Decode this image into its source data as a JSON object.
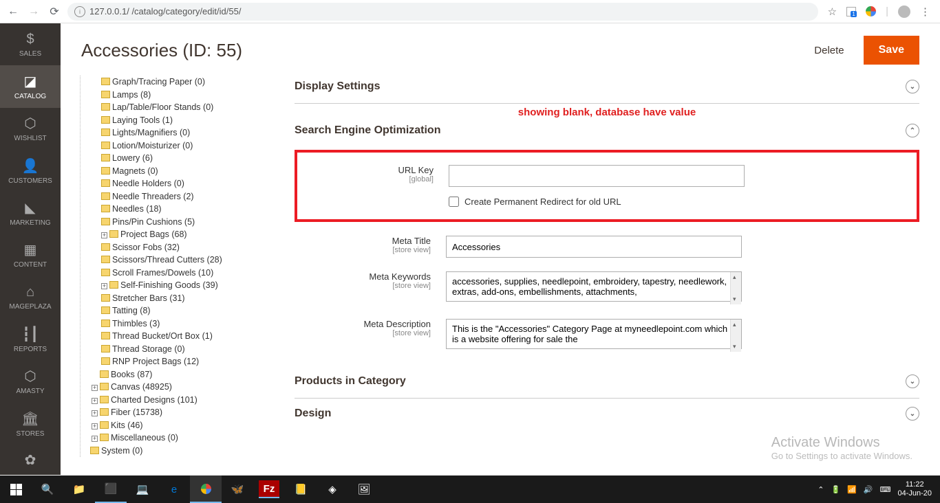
{
  "browser": {
    "url": "127.0.0.1/                                  /catalog/category/edit/id/55/"
  },
  "sidebar": {
    "items": [
      {
        "icon": "$",
        "label": "SALES"
      },
      {
        "icon": "📦",
        "label": "CATALOG"
      },
      {
        "icon": "⬡",
        "label": "WISHLIST"
      },
      {
        "icon": "👤",
        "label": "CUSTOMERS"
      },
      {
        "icon": "📣",
        "label": "MARKETING"
      },
      {
        "icon": "▦",
        "label": "CONTENT"
      },
      {
        "icon": "⌂",
        "label": "MAGEPLAZA"
      },
      {
        "icon": "📊",
        "label": "REPORTS"
      },
      {
        "icon": "⬡",
        "label": "AMASTY"
      },
      {
        "icon": "🏪",
        "label": "STORES"
      },
      {
        "icon": "⚙",
        "label": ""
      }
    ]
  },
  "page": {
    "title": "Accessories (ID: 55)",
    "delete_label": "Delete",
    "save_label": "Save"
  },
  "tree": [
    {
      "d": 1,
      "t": "Graph/Tracing Paper (0)"
    },
    {
      "d": 1,
      "t": "Lamps (8)"
    },
    {
      "d": 1,
      "t": "Lap/Table/Floor Stands (0)"
    },
    {
      "d": 1,
      "t": "Laying Tools (1)"
    },
    {
      "d": 1,
      "t": "Lights/Magnifiers (0)"
    },
    {
      "d": 1,
      "t": "Lotion/Moisturizer (0)"
    },
    {
      "d": 1,
      "t": "Lowery (6)"
    },
    {
      "d": 1,
      "t": "Magnets (0)"
    },
    {
      "d": 1,
      "t": "Needle Holders (0)"
    },
    {
      "d": 1,
      "t": "Needle Threaders (2)"
    },
    {
      "d": 1,
      "t": "Needles (18)"
    },
    {
      "d": 1,
      "t": "Pins/Pin Cushions (5)"
    },
    {
      "d": 1,
      "t": "Project Bags (68)",
      "e": true
    },
    {
      "d": 1,
      "t": "Scissor Fobs (32)"
    },
    {
      "d": 1,
      "t": "Scissors/Thread Cutters (28)"
    },
    {
      "d": 1,
      "t": "Scroll Frames/Dowels (10)"
    },
    {
      "d": 1,
      "t": "Self-Finishing Goods (39)",
      "e": true
    },
    {
      "d": 1,
      "t": "Stretcher Bars (31)"
    },
    {
      "d": 1,
      "t": "Tatting (8)"
    },
    {
      "d": 1,
      "t": "Thimbles (3)"
    },
    {
      "d": 1,
      "t": "Thread Bucket/Ort Box (1)"
    },
    {
      "d": 1,
      "t": "Thread Storage (0)"
    },
    {
      "d": 1,
      "t": "RNP Project Bags (12)"
    },
    {
      "d": 0,
      "t": "Books (87)"
    },
    {
      "d": 0,
      "t": "Canvas (48925)",
      "e": true
    },
    {
      "d": 0,
      "t": "Charted Designs (101)",
      "e": true
    },
    {
      "d": 0,
      "t": "Fiber (15738)",
      "e": true
    },
    {
      "d": 0,
      "t": "Kits (46)",
      "e": true
    },
    {
      "d": 0,
      "t": "Miscellaneous (0)",
      "e": true
    },
    {
      "d": 2,
      "t": "System (0)"
    }
  ],
  "sections": {
    "display": "Display Settings",
    "seo": "Search Engine Optimization",
    "products": "Products in Category",
    "design": "Design"
  },
  "annotation": "showing blank, database have value",
  "seo": {
    "url_key": {
      "label": "URL Key",
      "scope": "[global]",
      "value": ""
    },
    "redirect_label": "Create Permanent Redirect for old URL",
    "meta_title": {
      "label": "Meta Title",
      "scope": "[store view]",
      "value": "Accessories"
    },
    "meta_keywords": {
      "label": "Meta Keywords",
      "scope": "[store view]",
      "value": "accessories, supplies, needlepoint, embroidery, tapestry, needlework, extras, add-ons, embellishments, attachments,"
    },
    "meta_description": {
      "label": "Meta Description",
      "scope": "[store view]",
      "value": "This is the \"Accessories\" Category Page at myneedlepoint.com which is a website offering for sale the"
    }
  },
  "watermark": {
    "t1": "Activate Windows",
    "t2": "Go to Settings to activate Windows."
  },
  "taskbar": {
    "time": "11:22",
    "date": "04-Jun-20"
  }
}
